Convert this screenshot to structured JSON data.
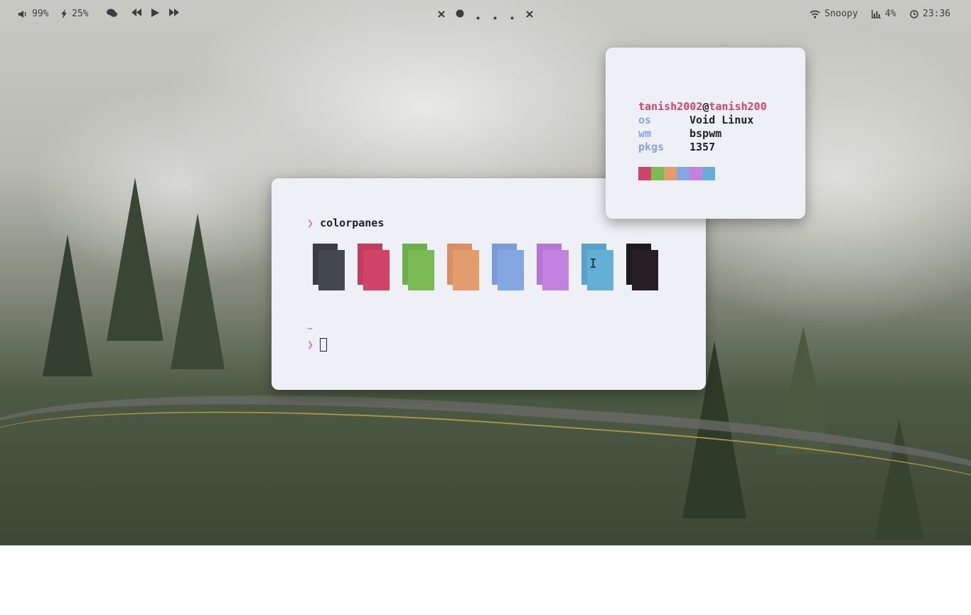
{
  "bar": {
    "volume": "99%",
    "battery": "25%",
    "wifi_name": "Snoopy",
    "cpu": "4%",
    "clock": "23:36"
  },
  "terminal": {
    "prompt_symbol": "❯",
    "command": "colorpanes",
    "cwd": "~",
    "panes": [
      {
        "color": "#43474f",
        "shadow": "#393c43"
      },
      {
        "color": "#d04468",
        "shadow": "#c23d5d"
      },
      {
        "color": "#7bba55",
        "shadow": "#6fae4b"
      },
      {
        "color": "#e39c6c",
        "shadow": "#d89062"
      },
      {
        "color": "#84a7e2",
        "shadow": "#7a9cd8"
      },
      {
        "color": "#c382df",
        "shadow": "#b577d3"
      },
      {
        "color": "#63afd6",
        "shadow": "#58a3cb"
      },
      {
        "color": "#271f23",
        "shadow": "#201a1d"
      }
    ]
  },
  "fetch": {
    "user": "tanish2002",
    "at": "@",
    "host": "tanish200",
    "rows": [
      {
        "key": "os",
        "value": "Void Linux"
      },
      {
        "key": "wm",
        "value": "bspwm"
      },
      {
        "key": "pkgs",
        "value": "1357"
      }
    ],
    "swatches": [
      "#d04468",
      "#7bba55",
      "#e39c6c",
      "#84a7e2",
      "#c382df",
      "#63afd6"
    ]
  }
}
